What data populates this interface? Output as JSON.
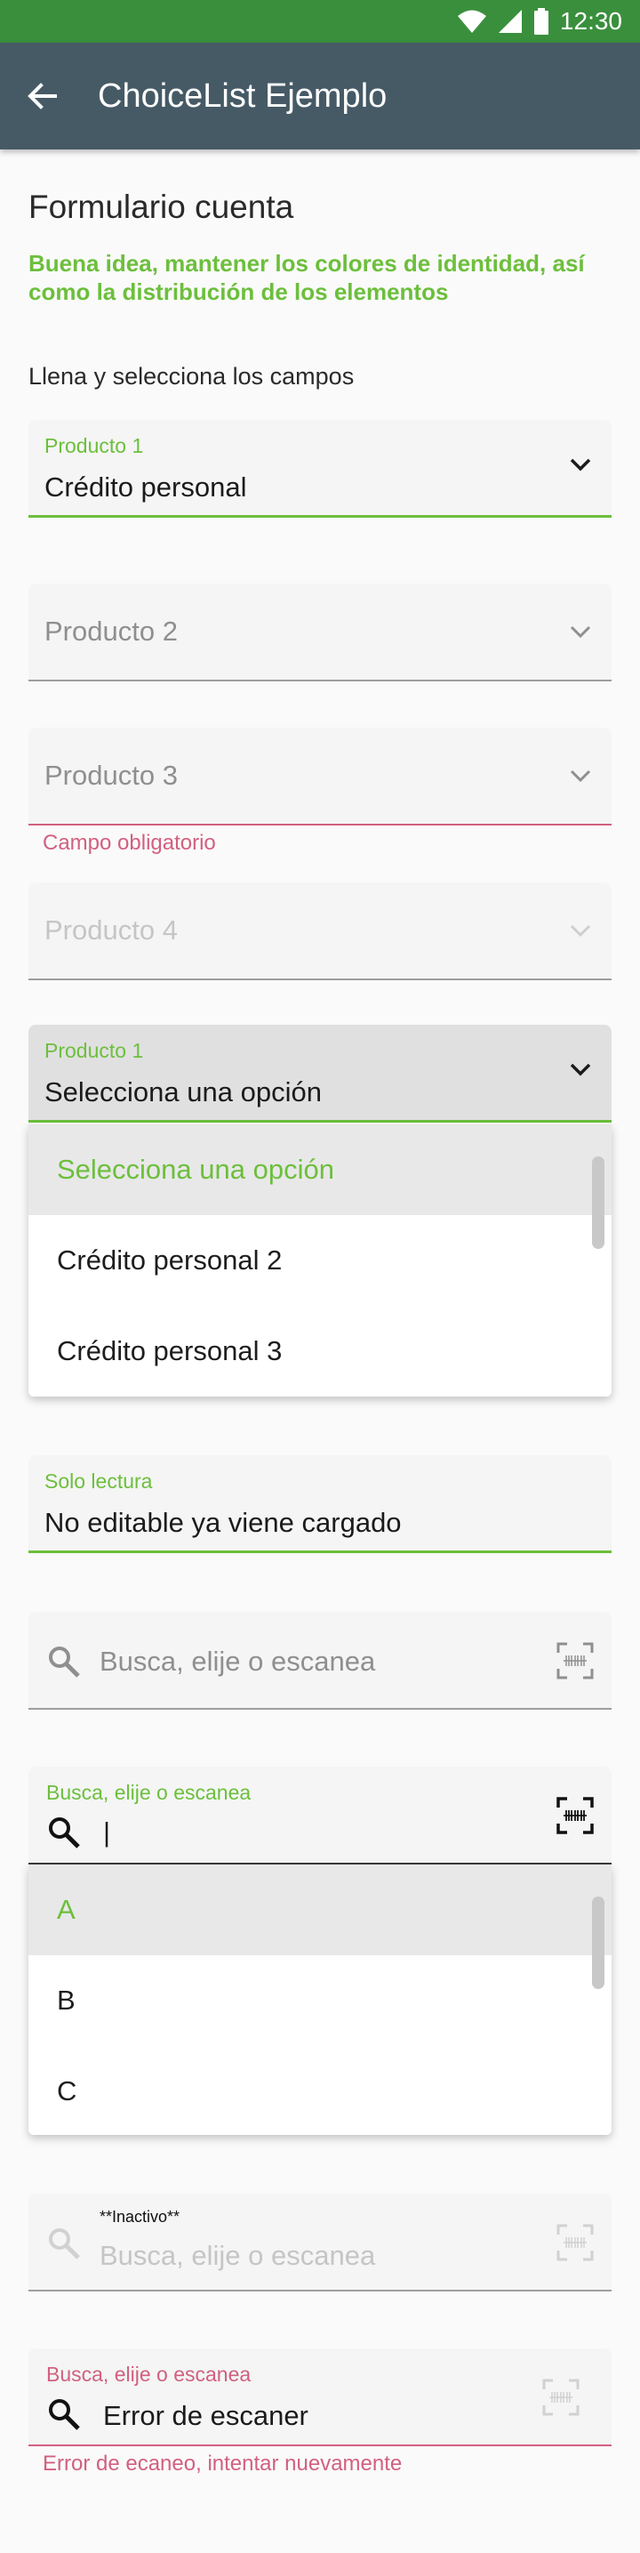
{
  "status_bar": {
    "time": "12:30",
    "icons": [
      "wifi-icon",
      "signal-icon",
      "battery-icon"
    ]
  },
  "app_bar": {
    "title": "ChoiceList Ejemplo",
    "back_icon": "arrow-back-icon"
  },
  "form": {
    "title": "Formulario cuenta",
    "subtitle": "Buena idea, mantener los colores de identidad, así como la distribución de los elementos",
    "instruction": "Llena y selecciona los campos"
  },
  "fields": {
    "producto1": {
      "label": "Producto 1",
      "value": "Crédito personal"
    },
    "producto2": {
      "placeholder": "Producto 2"
    },
    "producto3": {
      "placeholder": "Producto 3",
      "helper": "Campo obligatorio"
    },
    "producto4": {
      "placeholder": "Producto 4"
    },
    "producto1_open": {
      "label": "Producto 1",
      "value": "Selecciona una opción",
      "options": [
        "Selecciona una opción",
        "Crédito personal 2",
        "Crédito personal 3"
      ]
    },
    "readonly": {
      "label": "Solo lectura",
      "value": "No editable ya viene cargado"
    }
  },
  "search_fields": {
    "idle": {
      "placeholder": "Busca, elije o escanea"
    },
    "active": {
      "label": "Busca, elije o escanea",
      "value": "|",
      "options": [
        "A",
        "B",
        "C"
      ]
    },
    "inactive": {
      "tag": "**Inactivo**",
      "placeholder": "Busca, elije o escanea"
    },
    "error": {
      "label": "Busca, elije o escanea",
      "value": "Error de escaner",
      "helper": "Error de ecaneo, intentar nuevamente"
    }
  },
  "colors": {
    "accent": "#6cbf3c",
    "error": "#d26080",
    "appbar": "#465a66",
    "statusbar": "#3a8f3c"
  }
}
